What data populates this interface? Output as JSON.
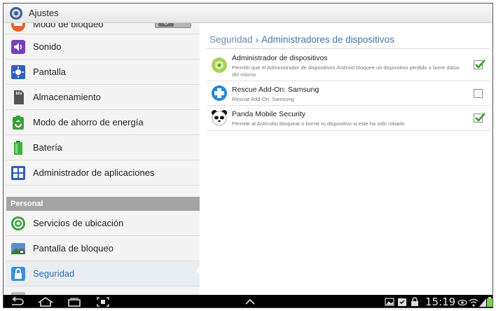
{
  "app": {
    "title": "Ajustes",
    "icon": "settings-gear-icon"
  },
  "sidebar": {
    "items": [
      {
        "label": "Modo de bloqueo",
        "icon": "block-mode-icon",
        "toggle": "O"
      },
      {
        "label": "Sonido",
        "icon": "speaker-icon"
      },
      {
        "label": "Pantalla",
        "icon": "display-icon"
      },
      {
        "label": "Almacenamiento",
        "icon": "sd-card-icon"
      },
      {
        "label": "Modo de ahorro de energía",
        "icon": "power-saving-icon"
      },
      {
        "label": "Batería",
        "icon": "battery-icon"
      },
      {
        "label": "Administrador de aplicaciones",
        "icon": "apps-grid-icon"
      }
    ],
    "section": "Personal",
    "personal_items": [
      {
        "label": "Servicios de ubicación",
        "icon": "location-icon"
      },
      {
        "label": "Pantalla de bloqueo",
        "icon": "lock-screen-icon"
      },
      {
        "label": "Seguridad",
        "icon": "lock-icon",
        "selected": true
      }
    ]
  },
  "main": {
    "breadcrumb": {
      "parent": "Seguridad",
      "separator": "›",
      "current": "Administradores de dispositivos"
    },
    "admins": [
      {
        "title": "Administrador de dispositivos",
        "desc": "Permitir que el Administrador de dispositivos Android bloquee un dispositivo perdido o borre datos del mismo",
        "checked": true,
        "icon": "device-manager-icon"
      },
      {
        "title": "Rescue Add-On: Samsung",
        "desc": "Rescue Add-On: Samsung",
        "checked": false,
        "icon": "rescue-plus-icon"
      },
      {
        "title": "Panda Mobile Security",
        "desc": "Permite al Antirrobo bloquear o borrar tu dispositivo si este ha sido robado",
        "checked": true,
        "icon": "panda-icon"
      }
    ]
  },
  "status": {
    "time": "15:19"
  },
  "colors": {
    "accent": "#2a6db4",
    "check": "#3a9a2a"
  }
}
